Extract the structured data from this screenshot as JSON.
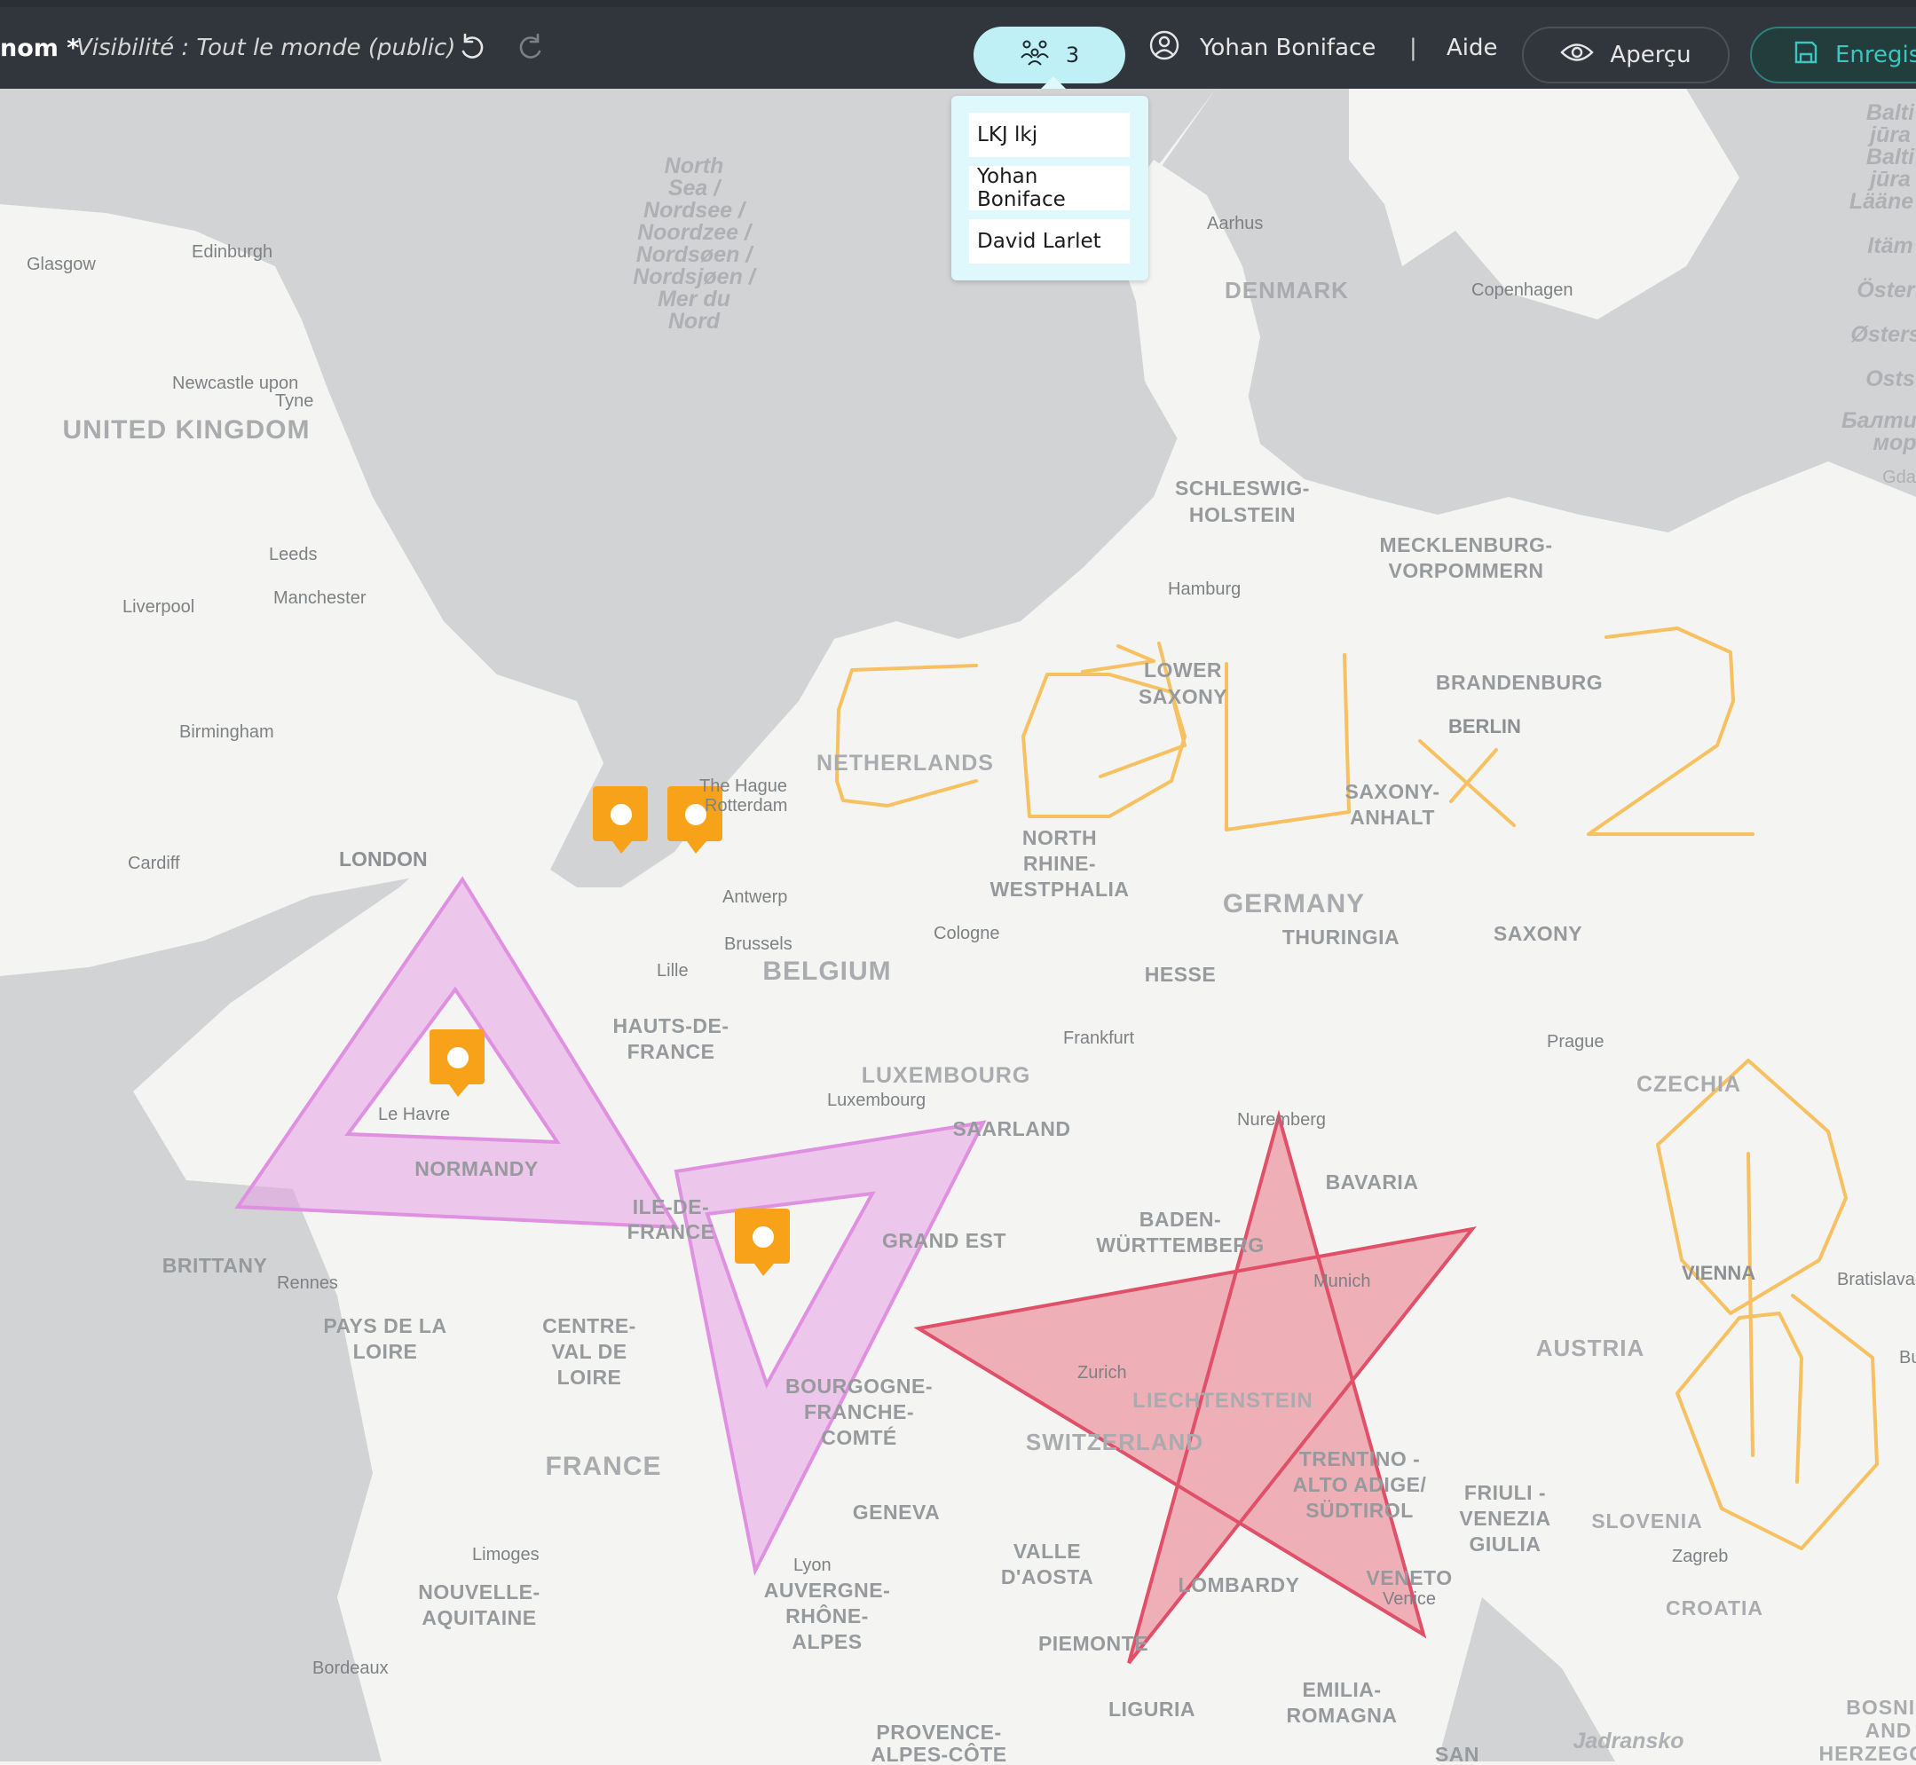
{
  "topbar": {
    "title": "nom *",
    "visibility": "Visibilité : Tout le monde (public)",
    "peers_count": "3",
    "user_name": "Yohan Boniface",
    "separator": "|",
    "help_label": "Aide",
    "preview_label": "Aperçu",
    "save_label": "Enregis"
  },
  "peers_dropdown": {
    "items": [
      "LKJ lkj",
      "Yohan Boniface",
      "David Larlet"
    ]
  },
  "map": {
    "colors": {
      "sea": "#d2d3d4",
      "land": "#f4f4f2",
      "marker": "#f7a218",
      "magenta": "#e6a0e6",
      "red": "#e85a6e",
      "orange": "#f7c060"
    },
    "seas": {
      "north_sea": [
        "North",
        "Sea /",
        "Nordsee /",
        "Noordzee /",
        "Nordsøen /",
        "Nordsjøen /",
        "Mer du",
        "Nord"
      ],
      "baltic": [
        "Balti",
        "jūra",
        "Balti",
        "jūra",
        "Lääne",
        "Itäm",
        "Öster",
        "Østers",
        "Osts",
        "Балтий",
        "мор",
        "Gda"
      ],
      "adriatic": "Jadransko"
    },
    "countries": [
      "UNITED KINGDOM",
      "DENMARK",
      "NETHERLANDS",
      "BELGIUM",
      "LUXEMBOURG",
      "GERMANY",
      "FRANCE",
      "SWITZERLAND",
      "LIECHTENSTEIN",
      "AUSTRIA",
      "CZECHIA",
      "SLOVENIA",
      "CROATIA",
      "BOSNIA",
      "AND",
      "HERZEGOV"
    ],
    "regions": [
      "SCHLESWIG-",
      "HOLSTEIN",
      "MECKLENBURG-",
      "VORPOMMERN",
      "LOWER",
      "SAXONY",
      "BRANDENBURG",
      "NORTH",
      "RHINE-",
      "WESTPHALIA",
      "SAXONY-",
      "ANHALT",
      "THURINGIA",
      "SAXONY",
      "HESSE",
      "SAARLAND",
      "BAVARIA",
      "BADEN-",
      "WÜRTTEMBERG",
      "HAUTS-DE-",
      "FRANCE",
      "NORMANDY",
      "ILE-DE-",
      "FRANCE",
      "GRAND EST",
      "BRITTANY",
      "PAYS DE LA",
      "LOIRE",
      "CENTRE-",
      "VAL DE",
      "LOIRE",
      "BOURGOGNE-",
      "FRANCHE-",
      "COMTÉ",
      "GENEVA",
      "VALLE",
      "D'AOSTA",
      "TRENTINO -",
      "ALTO ADIGE/",
      "SÜDTIROL",
      "FRIULI -",
      "VENEZIA",
      "GIULIA",
      "VENETO",
      "LOMBARDY",
      "PIEMONTE",
      "LIGURIA",
      "EMILIA-",
      "ROMAGNA",
      "NOUVELLE-",
      "AQUITAINE",
      "AUVERGNE-",
      "RHÔNE-",
      "ALPES",
      "PROVENCE-",
      "ALPES-CÔTE",
      "SAN"
    ],
    "cities": [
      "Glasgow",
      "Edinburgh",
      "Newcastle upon",
      "Tyne",
      "Leeds",
      "Liverpool",
      "Manchester",
      "Birmingham",
      "Cardiff",
      "LONDON",
      "Aarhus",
      "Copenhagen",
      "Hamburg",
      "BERLIN",
      "The Hague",
      "Rotterdam",
      "Antwerp",
      "Brussels",
      "Lille",
      "Cologne",
      "Frankfurt",
      "Luxembourg",
      "Le Havre",
      "Rennes",
      "Prague",
      "Nuremberg",
      "Munich",
      "Zurich",
      "VIENNA",
      "Bratislava",
      "Bu",
      "Zagreb",
      "Venice",
      "Limoges",
      "Bordeaux",
      "Lyon"
    ]
  }
}
